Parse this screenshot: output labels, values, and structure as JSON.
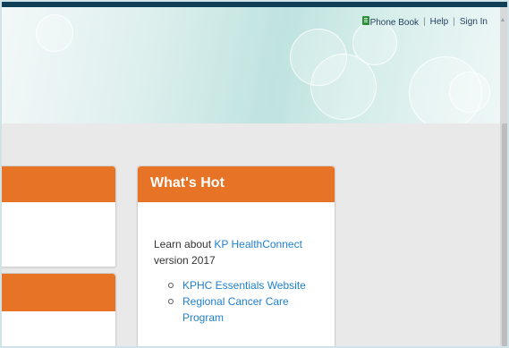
{
  "header": {
    "links": [
      "Phone Book",
      "Help",
      "Sign In"
    ],
    "separator": "|"
  },
  "whats_hot": {
    "title": "What's Hot",
    "intro_before": "Learn about ",
    "intro_link": "KP HealthConnect",
    "intro_after": " version 2017",
    "items": [
      "KPHC Essentials Website",
      "Regional Cancer Care Program"
    ]
  },
  "icons": {
    "phone_book": "book-icon",
    "scroll_up": "scroll-up-arrow-icon"
  },
  "colors": {
    "accent_orange": "#e77327",
    "link_blue": "#1f7fcf",
    "topbar": "#0e3f57"
  }
}
